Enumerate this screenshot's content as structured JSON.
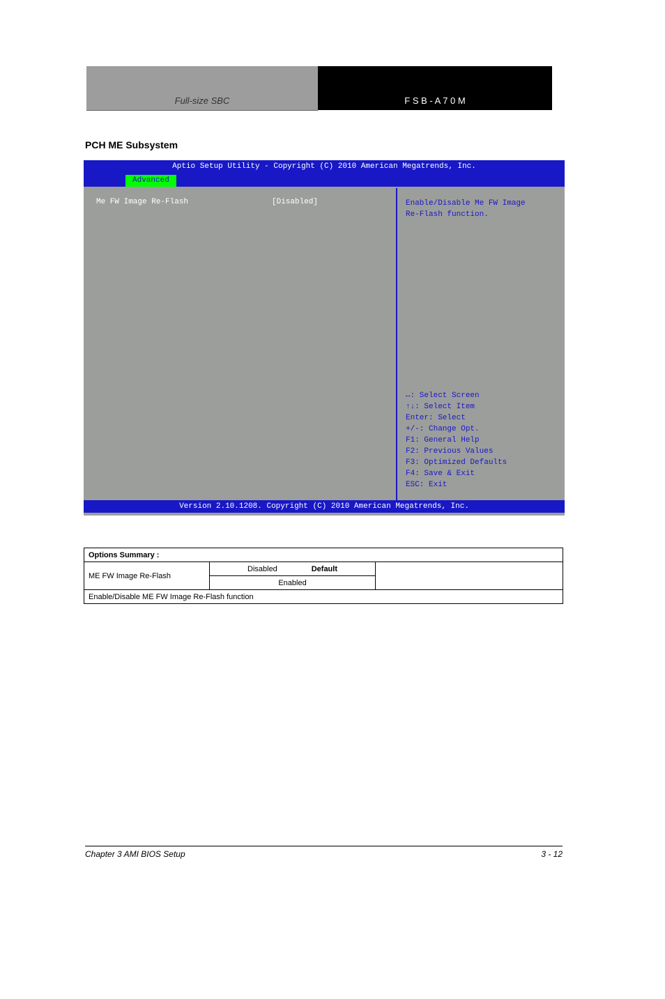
{
  "header": {
    "left": "Full-size SBC",
    "right": "F S B - A 7 0 M"
  },
  "section_title": "PCH ME Subsystem",
  "bios": {
    "title": "Aptio Setup Utility - Copyright (C) 2010 American Megatrends, Inc.",
    "tab": "Advanced",
    "row_label": "Me FW Image Re-Flash",
    "row_value": "[Disabled]",
    "help_top_1": "Enable/Disable Me FW Image",
    "help_top_2": "Re-Flash function.",
    "keys": {
      "k1": "↔: Select Screen",
      "k2": "↑↓: Select Item",
      "k3": "Enter: Select",
      "k4": "+/-: Change Opt.",
      "k5": "F1: General Help",
      "k6": "F2: Previous Values",
      "k7": "F3: Optimized Defaults",
      "k8": "F4: Save & Exit",
      "k9": "ESC: Exit"
    },
    "footer": "Version 2.10.1208. Copyright (C) 2010 American Megatrends, Inc."
  },
  "table": {
    "h_options": "Options Summary :",
    "r1_opt": "ME FW Image Re-Flash",
    "r1_v1": "Disabled",
    "r1_v1_note": "Default",
    "r1_v2": "Enabled",
    "r1_desc": "Enable/Disable ME FW Image Re-Flash function"
  },
  "footer": {
    "left": "Chapter 3 AMI BIOS Setup",
    "right": "3 - 12"
  }
}
